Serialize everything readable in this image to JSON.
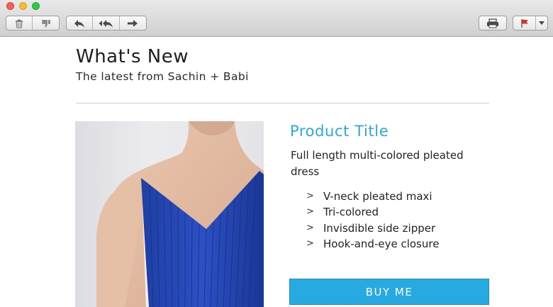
{
  "toolbar": {
    "buttons_left": [
      {
        "name": "trash-button",
        "icon": "trash-icon"
      },
      {
        "name": "junk-button",
        "icon": "thumbs-down-icon"
      }
    ],
    "buttons_reply": [
      {
        "name": "reply-button",
        "icon": "reply-arrow-icon"
      },
      {
        "name": "reply-all-button",
        "icon": "reply-all-icon"
      },
      {
        "name": "forward-button",
        "icon": "forward-arrow-icon"
      }
    ],
    "buttons_right": [
      {
        "name": "print-button",
        "icon": "printer-icon"
      },
      {
        "name": "flag-button",
        "icon": "flag-icon"
      }
    ]
  },
  "email": {
    "title": "What's New",
    "subtitle": "The latest from Sachin + Babi",
    "product": {
      "title": "Product Title",
      "description": "Full length multi-colored pleated dress",
      "features": [
        "V-neck pleated maxi",
        "Tri-colored",
        "Invisdible side zipper",
        "Hook-and-eye closure"
      ],
      "cta_label": "BUY ME",
      "accent_color": "#29aadf"
    }
  }
}
